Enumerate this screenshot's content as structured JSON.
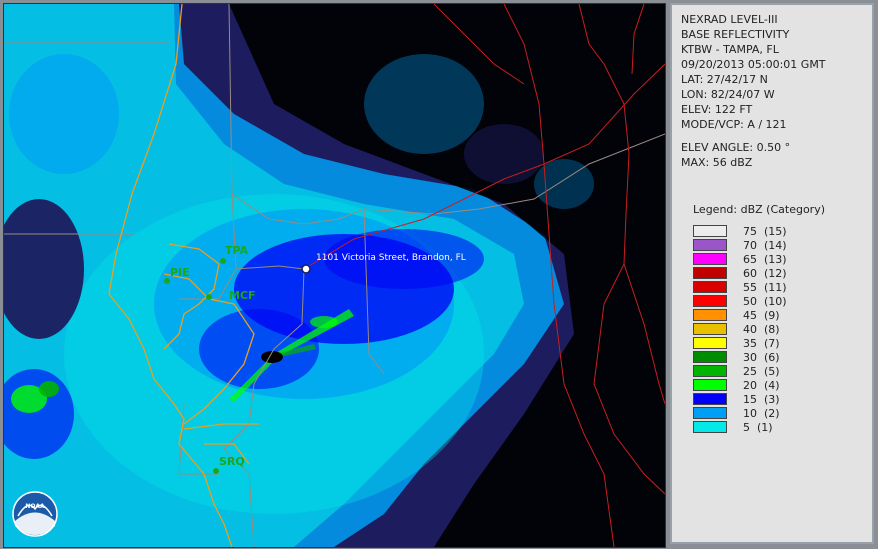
{
  "info": {
    "product": "NEXRAD LEVEL-III",
    "type": "BASE REFLECTIVITY",
    "station": "KTBW - TAMPA, FL",
    "datetime": "09/20/2013 05:00:01 GMT",
    "lat": "LAT: 27/42/17 N",
    "lon": "LON: 82/24/07 W",
    "elev": "ELEV: 122 FT",
    "mode": "MODE/VCP: A / 121",
    "elev_angle": "ELEV ANGLE: 0.50 °",
    "max": "MAX: 56 dBZ"
  },
  "legend": {
    "title": "Legend: dBZ (Category)",
    "items": [
      {
        "label": "75  (15)",
        "color": "#ececec"
      },
      {
        "label": "70  (14)",
        "color": "#9a56c8"
      },
      {
        "label": "65  (13)",
        "color": "#ff00ff"
      },
      {
        "label": "60  (12)",
        "color": "#c00000"
      },
      {
        "label": "55  (11)",
        "color": "#d80000"
      },
      {
        "label": "50  (10)",
        "color": "#ff0000"
      },
      {
        "label": "45  (9)",
        "color": "#ff9000"
      },
      {
        "label": "40  (8)",
        "color": "#e8c000"
      },
      {
        "label": "35  (7)",
        "color": "#ffff00"
      },
      {
        "label": "30  (6)",
        "color": "#008c00"
      },
      {
        "label": "25  (5)",
        "color": "#00b400"
      },
      {
        "label": "20  (4)",
        "color": "#00ff00"
      },
      {
        "label": "15  (3)",
        "color": "#0000f6"
      },
      {
        "label": "10  (2)",
        "color": "#019ff4"
      },
      {
        "label": "5  (1)",
        "color": "#04e9e7"
      }
    ]
  },
  "map": {
    "places": {
      "tpa": "TPA",
      "pie": "PIE",
      "mcf": "MCF",
      "srq": "SRQ"
    },
    "address": "1101 Victoria Street, Brandon, FL",
    "logo": "NOAA"
  },
  "colors": {
    "background": "#1c1c5e",
    "cyan": "#04e9e7",
    "light_blue": "#019ff4",
    "blue": "#0000f6",
    "green": "#00ff00",
    "county_line": "#9a8a80",
    "coast_line": "#e8a020",
    "highway": "#c81e1e",
    "place_label": "#1aa81a"
  }
}
